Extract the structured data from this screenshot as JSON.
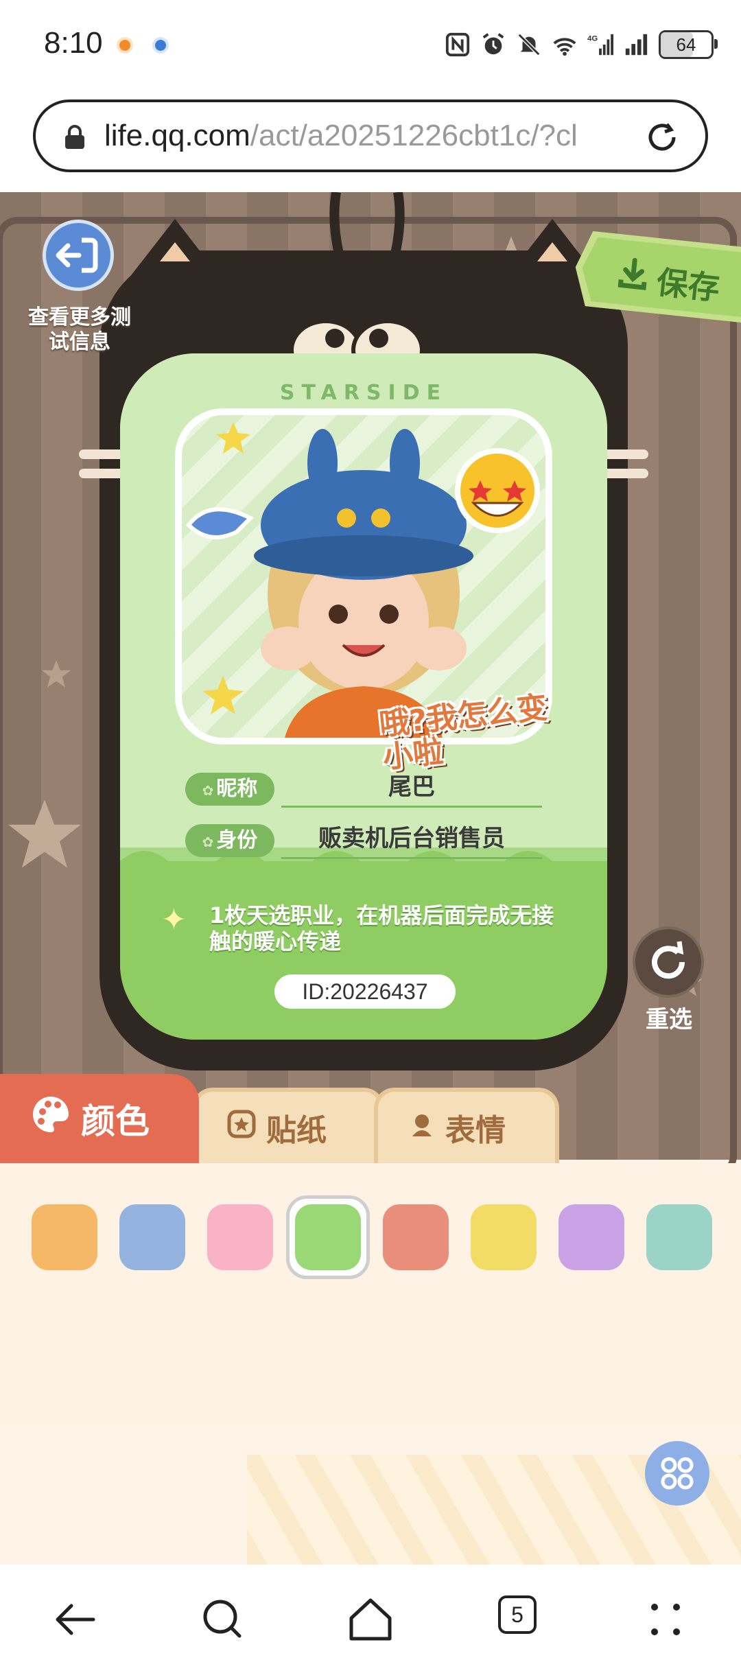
{
  "status_bar": {
    "time": "8:10",
    "battery": "64",
    "battery_level_percent": 64,
    "icons": [
      "nfc-icon",
      "alarm-icon",
      "mute-icon",
      "wifi-6-icon",
      "signal-4g-icon",
      "signal-icon",
      "battery-icon"
    ]
  },
  "browser": {
    "url_host": "life.qq.com",
    "url_path": "/act/a20251226cbt1c/?cl",
    "tab_count": "5"
  },
  "page": {
    "back_label": "查看更多测试信息",
    "save_label": "保存",
    "reset_label": "重选",
    "card": {
      "brand": "STARSIDE",
      "speech": "哦?我怎么变小啦",
      "nickname_label": "昵称",
      "nickname_value": "尾巴",
      "identity_label": "身份",
      "identity_value": "贩卖机后台销售员",
      "description": "1枚天选职业，在机器后面完成无接触的暖心传递",
      "id_text": "ID:20226437"
    },
    "tabs": [
      {
        "label": "颜色",
        "active": true
      },
      {
        "label": "贴纸",
        "active": false
      },
      {
        "label": "表情",
        "active": false
      }
    ],
    "swatches": [
      {
        "color": "#f5b866",
        "selected": false
      },
      {
        "color": "#94b4df",
        "selected": false
      },
      {
        "color": "#f9b2c6",
        "selected": false
      },
      {
        "color": "#9ad775",
        "selected": true
      },
      {
        "color": "#e88e7a",
        "selected": false
      },
      {
        "color": "#f2dc66",
        "selected": false
      },
      {
        "color": "#c9a3e6",
        "selected": false
      },
      {
        "color": "#9bd3c6",
        "selected": false
      }
    ]
  },
  "colors": {
    "accent_tab": "#e36c52",
    "card_green": "#a7d886",
    "wall_brown": "#8a7466"
  }
}
